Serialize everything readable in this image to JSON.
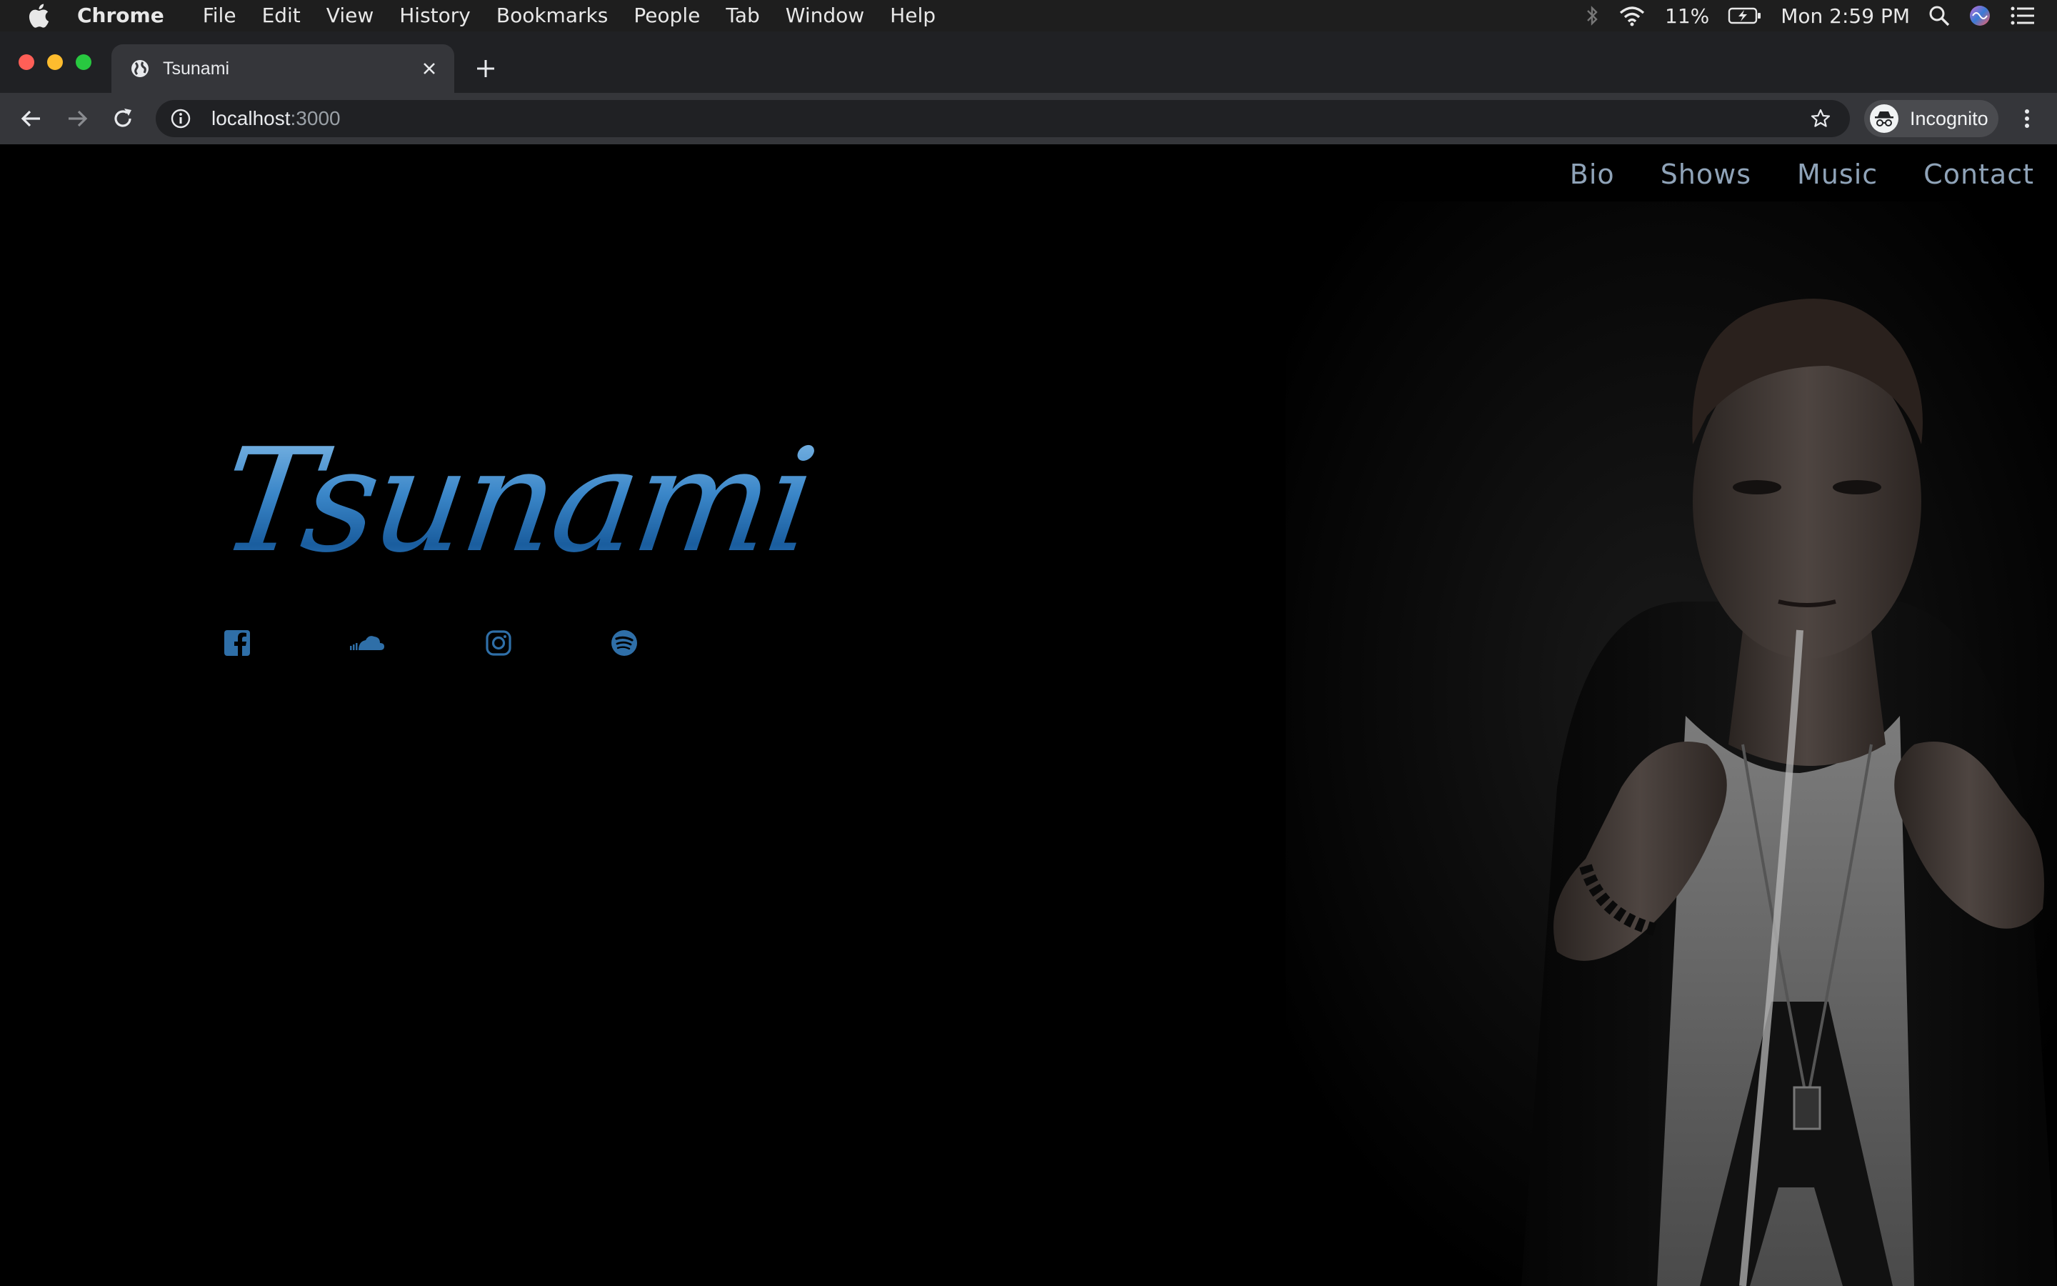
{
  "menubar": {
    "app_name": "Chrome",
    "items": [
      "File",
      "Edit",
      "View",
      "History",
      "Bookmarks",
      "People",
      "Tab",
      "Window",
      "Help"
    ],
    "battery": "11%",
    "clock": "Mon 2:59 PM"
  },
  "browser": {
    "tab_title": "Tsunami",
    "url_host": "localhost",
    "url_port": ":3000",
    "profile_label": "Incognito"
  },
  "site": {
    "nav": [
      "Bio",
      "Shows",
      "Music",
      "Contact"
    ],
    "logo_text": "Tsunami",
    "socials": [
      "facebook-icon",
      "soundcloud-icon",
      "instagram-icon",
      "spotify-icon"
    ],
    "accent_color": "#8fa3b8",
    "brand_blue": "#2f6fa8"
  }
}
